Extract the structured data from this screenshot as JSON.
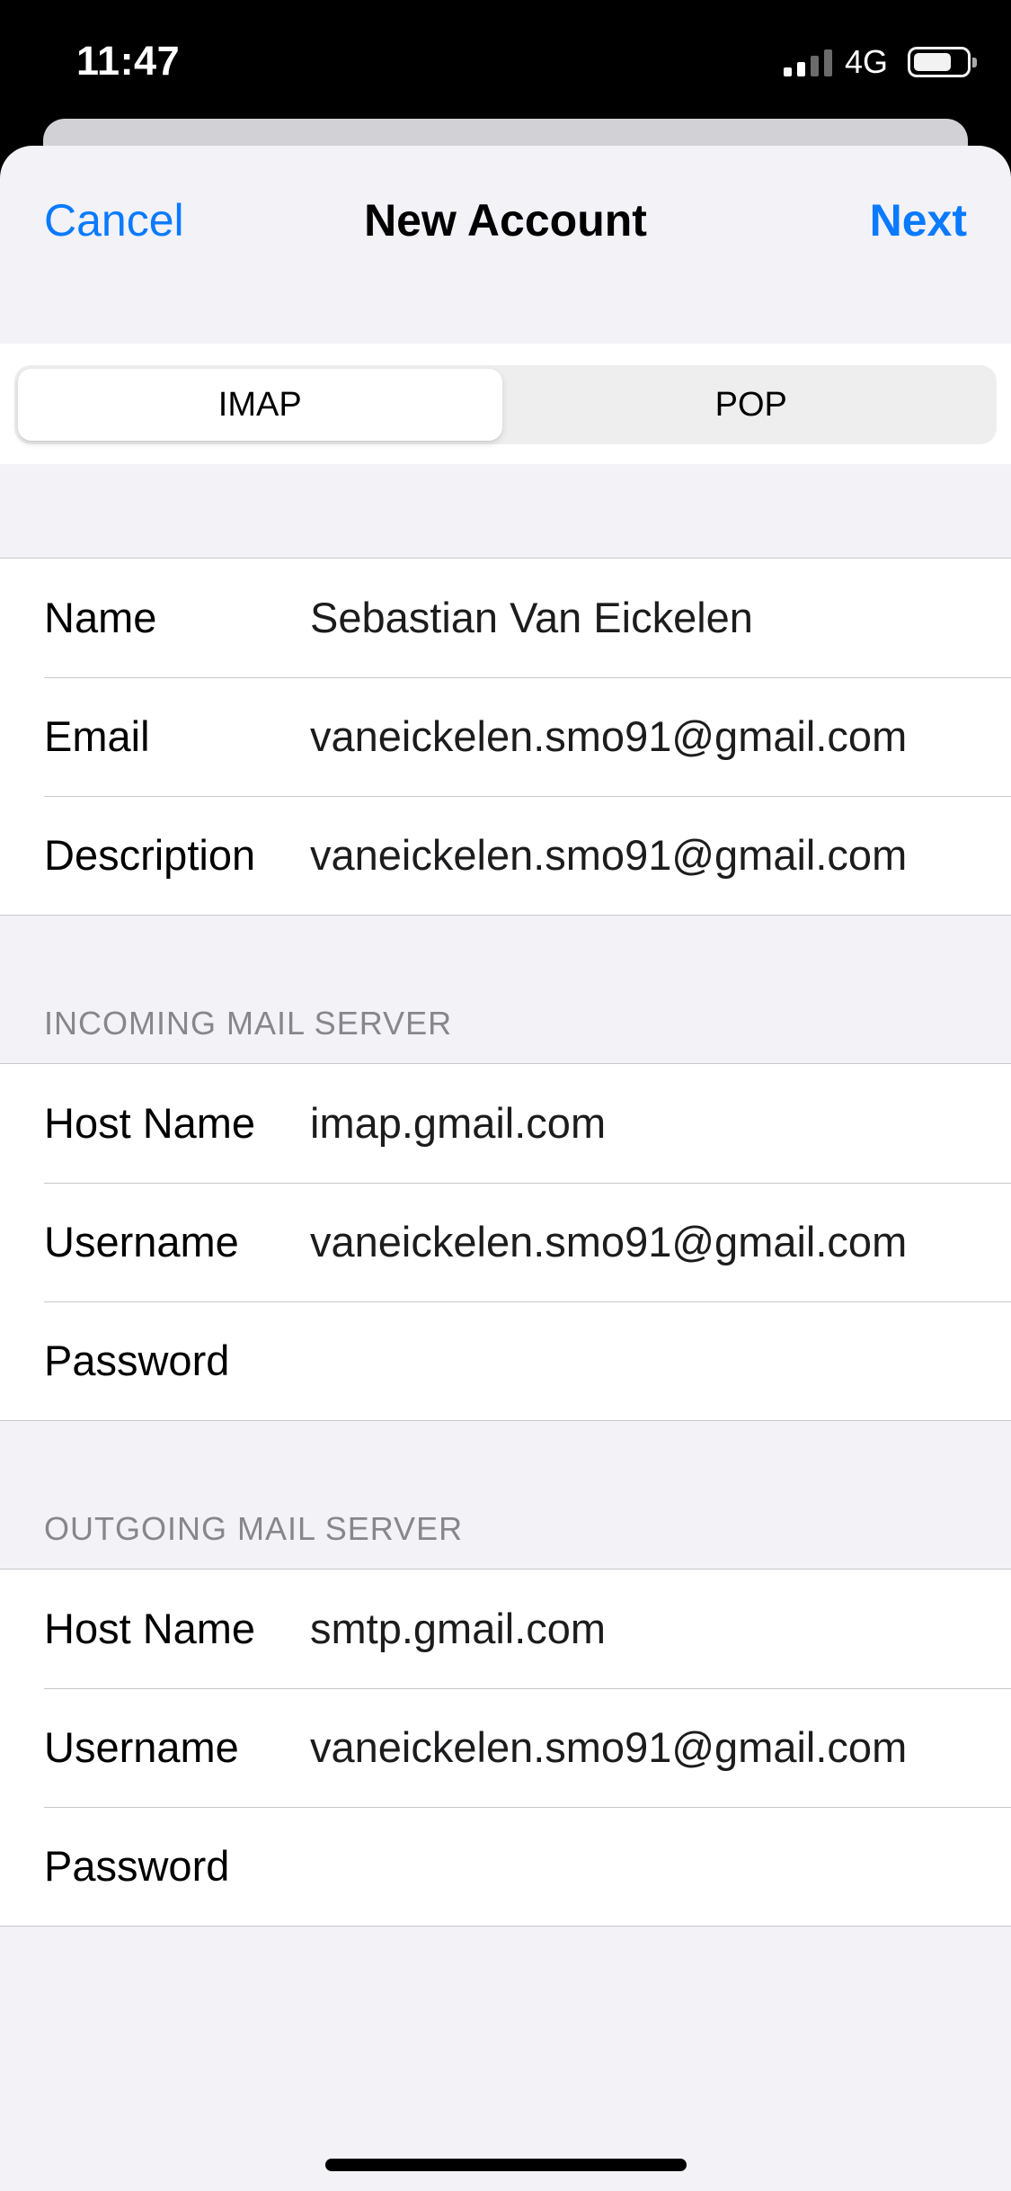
{
  "status_bar": {
    "time": "11:47",
    "network": "4G",
    "signal_bars_active": 2,
    "signal_bars_total": 4,
    "battery_level": 0.7
  },
  "nav": {
    "cancel_label": "Cancel",
    "title": "New Account",
    "next_label": "Next",
    "accent_color": "#0a7aff"
  },
  "protocol_segment": {
    "options": [
      "IMAP",
      "POP"
    ],
    "selected": "IMAP"
  },
  "account": {
    "name_label": "Name",
    "name_value": "Sebastian Van Eickelen",
    "email_label": "Email",
    "email_value": "vaneickelen.smo91@gmail.com",
    "description_label": "Description",
    "description_value": "vaneickelen.smo91@gmail.com"
  },
  "incoming": {
    "header": "INCOMING MAIL SERVER",
    "host_label": "Host Name",
    "host_value": "imap.gmail.com",
    "username_label": "Username",
    "username_value": "vaneickelen.smo91@gmail.com",
    "password_label": "Password",
    "password_value": ""
  },
  "outgoing": {
    "header": "OUTGOING MAIL SERVER",
    "host_label": "Host Name",
    "host_value": "smtp.gmail.com",
    "username_label": "Username",
    "username_value": "vaneickelen.smo91@gmail.com",
    "password_label": "Password",
    "password_value": ""
  }
}
